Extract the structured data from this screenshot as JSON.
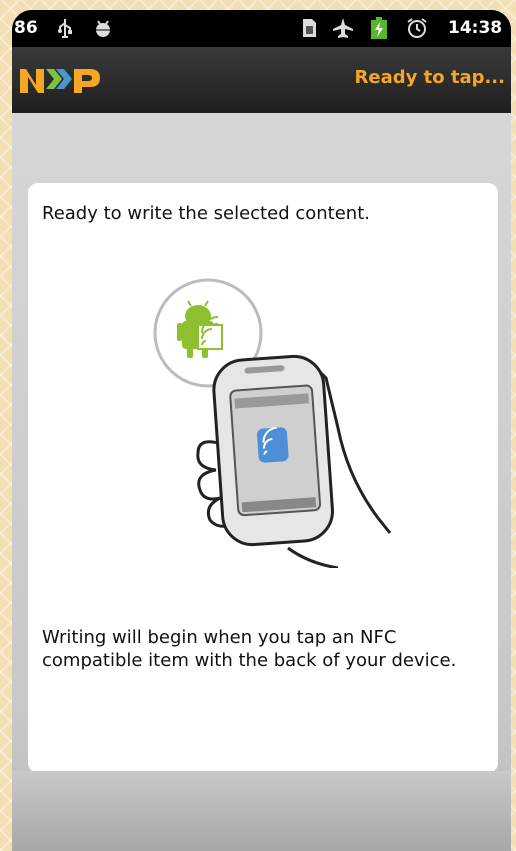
{
  "status_bar": {
    "notification_count": "86",
    "time": "14:38",
    "icons": [
      "usb-icon",
      "android-debug-icon",
      "sim-icon",
      "airplane-icon",
      "battery-charging-icon",
      "alarm-icon"
    ]
  },
  "app_bar": {
    "logo_text": "NXP",
    "status": "Ready to tap..."
  },
  "card": {
    "title": "Ready to write the selected content.",
    "description": "Writing will begin when you tap an NFC compatible item with the back of your device."
  },
  "colors": {
    "accent": "#f5a623",
    "android_green": "#8dbf2e",
    "nfc_blue": "#4d8fd6"
  }
}
